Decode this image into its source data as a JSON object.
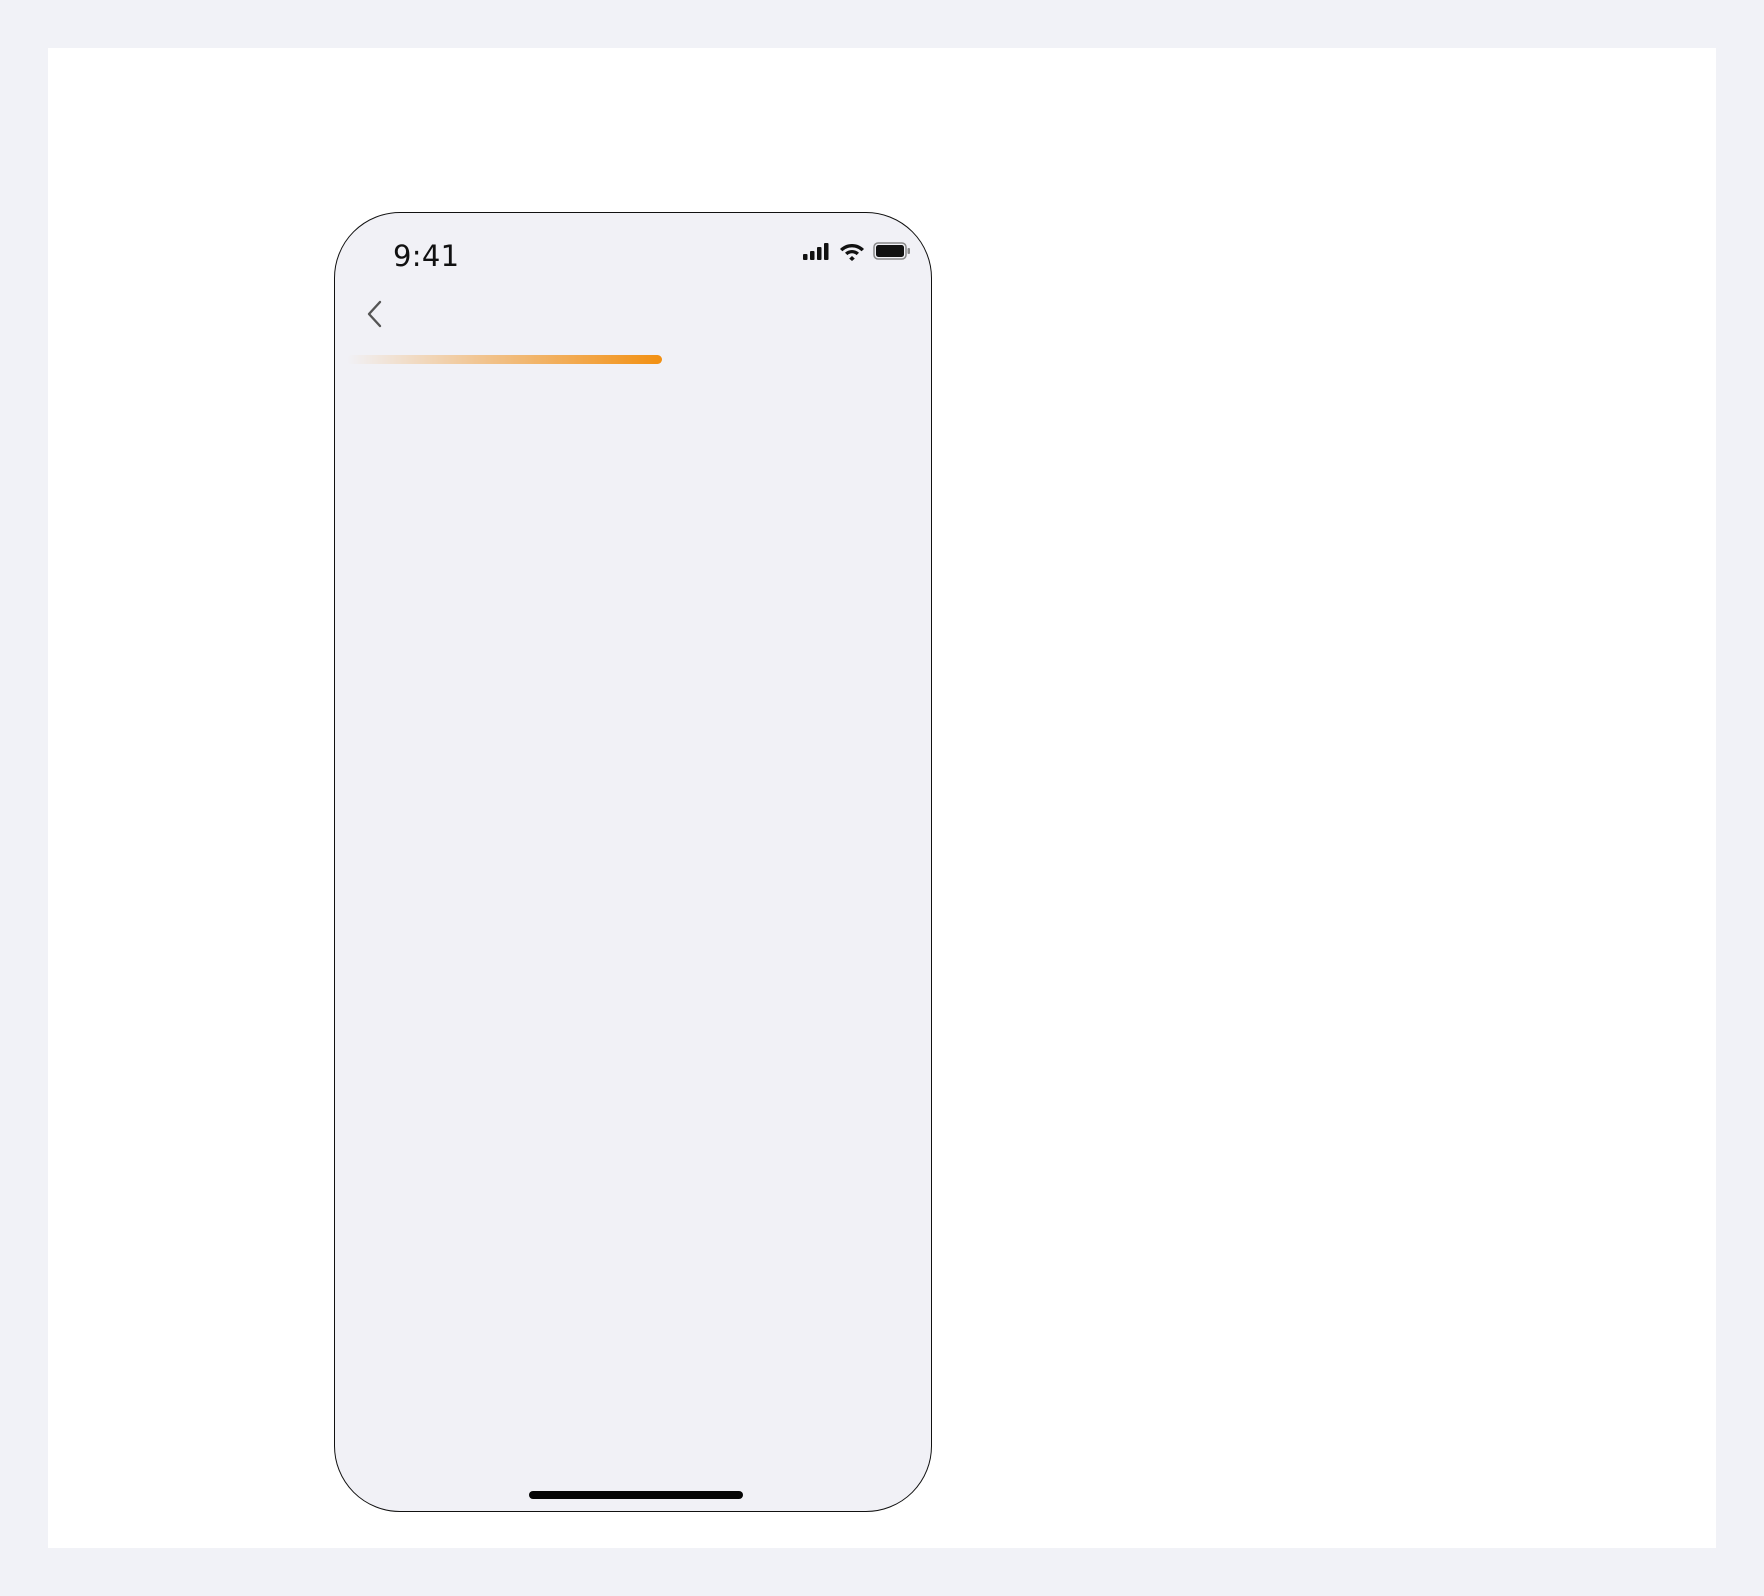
{
  "status_bar": {
    "time": "9:41",
    "icons": [
      "signal-icon",
      "wifi-icon",
      "battery-icon"
    ]
  },
  "nav": {
    "back_icon": "chevron-left-icon"
  },
  "progress": {
    "fraction": 0.55,
    "colors": {
      "start": "#f1911e00",
      "end": "#f29012"
    }
  },
  "colors": {
    "page_background": "#f1f2f7",
    "canvas_background": "#ffffff",
    "screen_background": "#f1f1f6",
    "accent": "#f29012"
  }
}
